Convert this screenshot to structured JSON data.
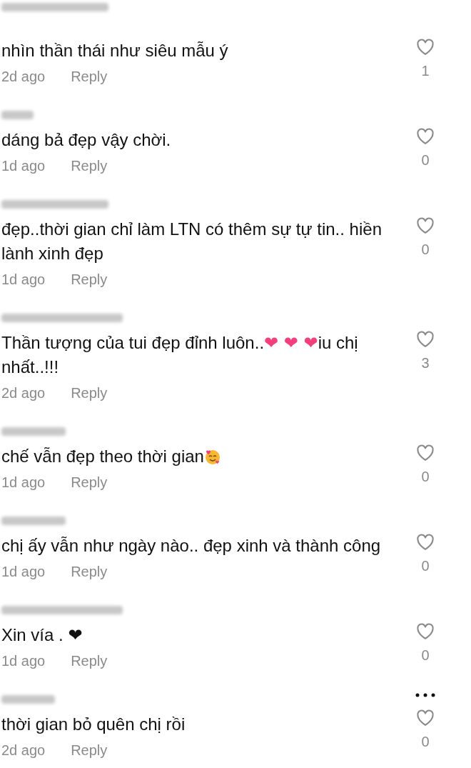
{
  "comments": [
    {
      "parts": [
        {
          "kind": "text",
          "text": "nhìn thần thái như siêu mẫu ý"
        }
      ],
      "time": "2d ago",
      "reply": "Reply",
      "likes": "1",
      "liked": false,
      "more": false
    },
    {
      "parts": [
        {
          "kind": "text",
          "text": "dáng bả đẹp vậy chời."
        }
      ],
      "time": "1d ago",
      "reply": "Reply",
      "likes": "0",
      "liked": false,
      "more": false
    },
    {
      "parts": [
        {
          "kind": "text",
          "text": "đẹp..thời gian chỉ làm LTN có thêm sự tự tin.. hiền lành xinh đẹp"
        }
      ],
      "time": "1d ago",
      "reply": "Reply",
      "likes": "0",
      "liked": false,
      "more": false
    },
    {
      "parts": [
        {
          "kind": "text",
          "text": "Thần tượng của tui đẹp đỉnh luôn.."
        },
        {
          "kind": "emoji",
          "text": "❤ ",
          "color": "#f43f7f"
        },
        {
          "kind": "emoji",
          "text": "❤ ",
          "color": "#f43f7f"
        },
        {
          "kind": "emoji",
          "text": "❤",
          "color": "#f43f7f"
        },
        {
          "kind": "text",
          "text": "iu chị nhất..!!!"
        }
      ],
      "time": "2d ago",
      "reply": "Reply",
      "likes": "3",
      "liked": false,
      "more": false
    },
    {
      "parts": [
        {
          "kind": "text",
          "text": "chế vẫn đẹp theo thời gian"
        },
        {
          "kind": "face"
        }
      ],
      "time": "1d ago",
      "reply": "Reply",
      "likes": "0",
      "liked": false,
      "more": false
    },
    {
      "parts": [
        {
          "kind": "text",
          "text": "chị ấy vẫn như ngày nào.. đẹp xinh và thành công"
        }
      ],
      "time": "1d ago",
      "reply": "Reply",
      "likes": "0",
      "liked": false,
      "more": false
    },
    {
      "parts": [
        {
          "kind": "text",
          "text": "Xin vía . "
        },
        {
          "kind": "emoji",
          "text": "❤",
          "color": "#111111"
        }
      ],
      "time": "1d ago",
      "reply": "Reply",
      "likes": "0",
      "liked": false,
      "more": false
    },
    {
      "parts": [
        {
          "kind": "text",
          "text": "thời gian bỏ quên chị rồi"
        }
      ],
      "time": "2d ago",
      "reply": "Reply",
      "likes": "0",
      "liked": false,
      "more": true
    }
  ]
}
